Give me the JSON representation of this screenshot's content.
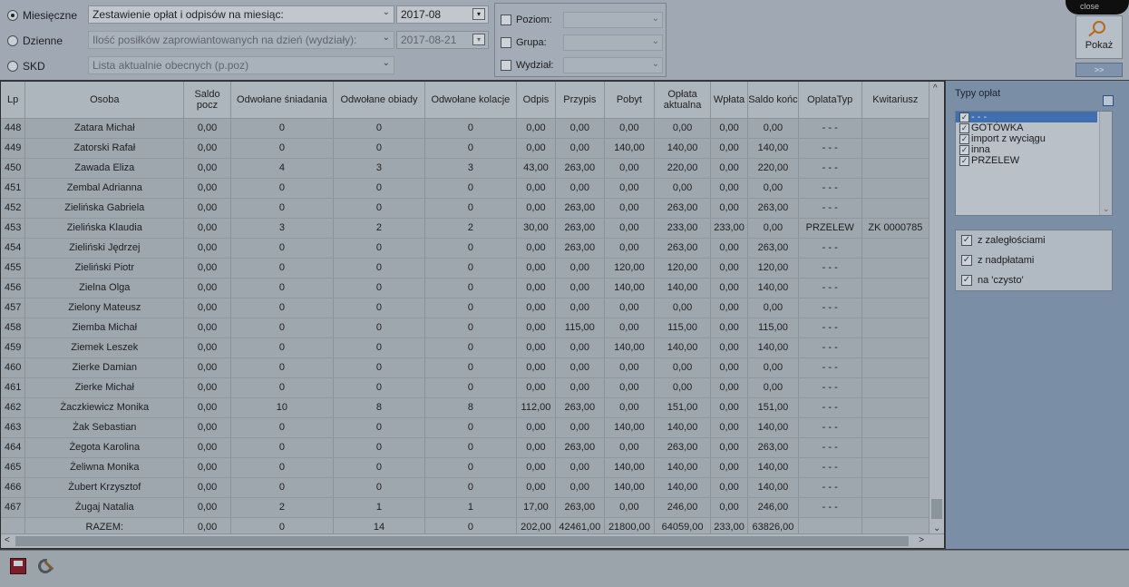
{
  "mode_options": [
    {
      "label": "Miesięczne",
      "selected": true,
      "report": "Zestawienie opłat i odpisów na miesiąc:",
      "date": "2017-08",
      "enabled": true
    },
    {
      "label": "Dzienne",
      "selected": false,
      "report": "Ilość posiłków zaprowiantowanych na dzień (wydziały):",
      "date": "2017-08-21",
      "enabled": false
    },
    {
      "label": "SKD",
      "selected": false,
      "report": "Lista aktualnie obecnych (p.poz)",
      "enabled": false
    }
  ],
  "filters": {
    "level_label": "Poziom:",
    "group_label": "Grupa:",
    "dept_label": "Wydział:"
  },
  "show_button": {
    "label": "Pokaż"
  },
  "more_button": {
    "label": ">>"
  },
  "close_tab": {
    "label": "close"
  },
  "table": {
    "columns": [
      "Lp",
      "Osoba",
      "Saldo pocz",
      "Odwołane śniadania",
      "Odwołane obiady",
      "Odwołane kolacje",
      "Odpis",
      "Przypis",
      "Pobyt",
      "Opłata aktualna",
      "Wpłata",
      "Saldo końc",
      "OplataTyp",
      "Kwitariusz"
    ],
    "rows": [
      [
        "448",
        "Zatara Michał",
        "0,00",
        "0",
        "0",
        "0",
        "0,00",
        "0,00",
        "0,00",
        "0,00",
        "0,00",
        "0,00",
        "- - -",
        ""
      ],
      [
        "449",
        "Zatorski Rafał",
        "0,00",
        "0",
        "0",
        "0",
        "0,00",
        "0,00",
        "140,00",
        "140,00",
        "0,00",
        "140,00",
        "- - -",
        ""
      ],
      [
        "450",
        "Zawada Eliza",
        "0,00",
        "4",
        "3",
        "3",
        "43,00",
        "263,00",
        "0,00",
        "220,00",
        "0,00",
        "220,00",
        "- - -",
        ""
      ],
      [
        "451",
        "Zembal Adrianna",
        "0,00",
        "0",
        "0",
        "0",
        "0,00",
        "0,00",
        "0,00",
        "0,00",
        "0,00",
        "0,00",
        "- - -",
        ""
      ],
      [
        "452",
        "Zielińska Gabriela",
        "0,00",
        "0",
        "0",
        "0",
        "0,00",
        "263,00",
        "0,00",
        "263,00",
        "0,00",
        "263,00",
        "- - -",
        ""
      ],
      [
        "453",
        "Zielińska Klaudia",
        "0,00",
        "3",
        "2",
        "2",
        "30,00",
        "263,00",
        "0,00",
        "233,00",
        "233,00",
        "0,00",
        "PRZELEW",
        "ZK 0000785"
      ],
      [
        "454",
        "Zieliński Jędrzej",
        "0,00",
        "0",
        "0",
        "0",
        "0,00",
        "263,00",
        "0,00",
        "263,00",
        "0,00",
        "263,00",
        "- - -",
        ""
      ],
      [
        "455",
        "Zieliński Piotr",
        "0,00",
        "0",
        "0",
        "0",
        "0,00",
        "0,00",
        "120,00",
        "120,00",
        "0,00",
        "120,00",
        "- - -",
        ""
      ],
      [
        "456",
        "Zielna Olga",
        "0,00",
        "0",
        "0",
        "0",
        "0,00",
        "0,00",
        "140,00",
        "140,00",
        "0,00",
        "140,00",
        "- - -",
        ""
      ],
      [
        "457",
        "Zielony Mateusz",
        "0,00",
        "0",
        "0",
        "0",
        "0,00",
        "0,00",
        "0,00",
        "0,00",
        "0,00",
        "0,00",
        "- - -",
        ""
      ],
      [
        "458",
        "Ziemba Michał",
        "0,00",
        "0",
        "0",
        "0",
        "0,00",
        "115,00",
        "0,00",
        "115,00",
        "0,00",
        "115,00",
        "- - -",
        ""
      ],
      [
        "459",
        "Ziemek Leszek",
        "0,00",
        "0",
        "0",
        "0",
        "0,00",
        "0,00",
        "140,00",
        "140,00",
        "0,00",
        "140,00",
        "- - -",
        ""
      ],
      [
        "460",
        "Zierke Damian",
        "0,00",
        "0",
        "0",
        "0",
        "0,00",
        "0,00",
        "0,00",
        "0,00",
        "0,00",
        "0,00",
        "- - -",
        ""
      ],
      [
        "461",
        "Zierke Michał",
        "0,00",
        "0",
        "0",
        "0",
        "0,00",
        "0,00",
        "0,00",
        "0,00",
        "0,00",
        "0,00",
        "- - -",
        ""
      ],
      [
        "462",
        "Żaczkiewicz Monika",
        "0,00",
        "10",
        "8",
        "8",
        "112,00",
        "263,00",
        "0,00",
        "151,00",
        "0,00",
        "151,00",
        "- - -",
        ""
      ],
      [
        "463",
        "Żak Sebastian",
        "0,00",
        "0",
        "0",
        "0",
        "0,00",
        "0,00",
        "140,00",
        "140,00",
        "0,00",
        "140,00",
        "- - -",
        ""
      ],
      [
        "464",
        "Żegota Karolina",
        "0,00",
        "0",
        "0",
        "0",
        "0,00",
        "263,00",
        "0,00",
        "263,00",
        "0,00",
        "263,00",
        "- - -",
        ""
      ],
      [
        "465",
        "Żeliwna Monika",
        "0,00",
        "0",
        "0",
        "0",
        "0,00",
        "0,00",
        "140,00",
        "140,00",
        "0,00",
        "140,00",
        "- - -",
        ""
      ],
      [
        "466",
        "Żubert Krzysztof",
        "0,00",
        "0",
        "0",
        "0",
        "0,00",
        "0,00",
        "140,00",
        "140,00",
        "0,00",
        "140,00",
        "- - -",
        ""
      ],
      [
        "467",
        "Żugaj Natalia",
        "0,00",
        "2",
        "1",
        "1",
        "17,00",
        "263,00",
        "0,00",
        "246,00",
        "0,00",
        "246,00",
        "- - -",
        ""
      ]
    ],
    "total": [
      "",
      "RAZEM:",
      "0,00",
      "0",
      "14",
      "0",
      "202,00",
      "42461,00",
      "21800,00",
      "64059,00",
      "233,00",
      "63826,00",
      "",
      ""
    ]
  },
  "payment_types": {
    "title": "Typy opłat",
    "items": [
      {
        "label": "- - -",
        "checked": true,
        "selected": true
      },
      {
        "label": "GOTÓWKA",
        "checked": true
      },
      {
        "label": "import z wyciągu",
        "checked": true
      },
      {
        "label": "inna",
        "checked": true
      },
      {
        "label": "PRZELEW",
        "checked": true
      }
    ]
  },
  "options": [
    {
      "label": "z zaległościami",
      "checked": true
    },
    {
      "label": "z nadpłatami",
      "checked": true
    },
    {
      "label": "na 'czysto'",
      "checked": true
    }
  ],
  "icons": {
    "save": "save-icon",
    "tools": "tools-icon",
    "show": "magnifier-icon"
  }
}
